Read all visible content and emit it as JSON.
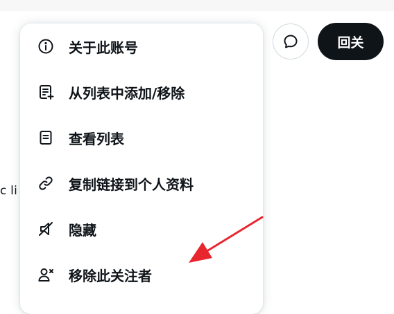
{
  "background": {
    "partial_text": "c li"
  },
  "header": {
    "follow_label": "回关"
  },
  "menu": {
    "items": [
      {
        "label": "关于此账号",
        "icon": "info-icon"
      },
      {
        "label": "从列表中添加/移除",
        "icon": "list-add-icon"
      },
      {
        "label": "查看列表",
        "icon": "list-icon"
      },
      {
        "label": "复制链接到个人资料",
        "icon": "link-icon"
      },
      {
        "label": "隐藏",
        "icon": "mute-icon"
      },
      {
        "label": "移除此关注者",
        "icon": "remove-follower-icon"
      }
    ]
  },
  "colors": {
    "text": "#0f1419",
    "button_bg": "#0f1419",
    "arrow": "#e8262e"
  }
}
